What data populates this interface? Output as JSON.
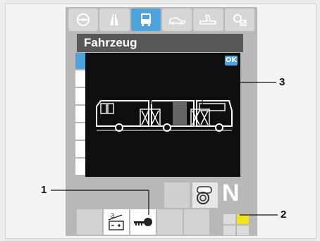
{
  "screen": {
    "title": "Fahrzeug",
    "ok_label": "OK",
    "tabs": [
      {
        "icon": "steering-wheel-icon",
        "active": false
      },
      {
        "icon": "road-icon",
        "active": false
      },
      {
        "icon": "bus-icon",
        "active": true
      },
      {
        "icon": "car-settings-icon",
        "active": false
      },
      {
        "icon": "service-icon",
        "active": false
      },
      {
        "icon": "tools-settings-icon",
        "active": false
      }
    ],
    "gear": "N",
    "trailer_indicator": {
      "numerator": "3",
      "symbols": "— +"
    }
  },
  "callouts": [
    {
      "number": "1"
    },
    {
      "number": "2"
    },
    {
      "number": "3"
    }
  ],
  "colors": {
    "accent": "#4fa3db",
    "header": "#575757",
    "panel": "#0f0f0f",
    "warning": "#f2e41c"
  }
}
